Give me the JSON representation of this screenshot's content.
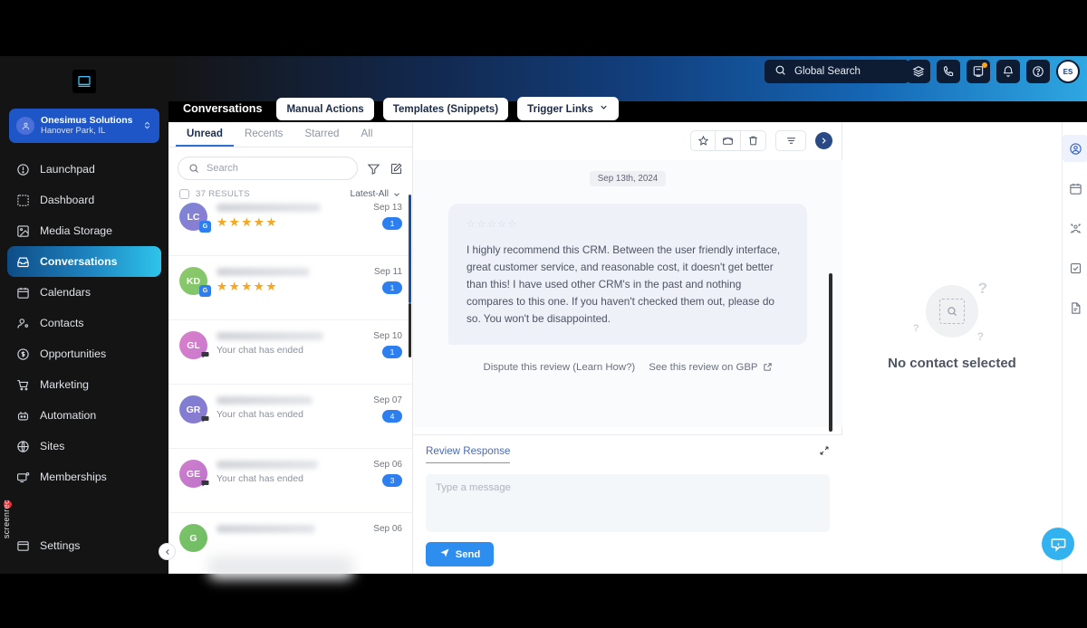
{
  "sidebar": {
    "logo": "app-logo",
    "account": {
      "name": "Onesimus Solutions",
      "location": "Hanover Park, IL"
    },
    "items": [
      {
        "label": "Launchpad",
        "icon": "rocket-icon"
      },
      {
        "label": "Dashboard",
        "icon": "dashboard-icon"
      },
      {
        "label": "Media Storage",
        "icon": "media-icon"
      },
      {
        "label": "Conversations",
        "icon": "inbox-icon"
      },
      {
        "label": "Calendars",
        "icon": "calendar-icon"
      },
      {
        "label": "Contacts",
        "icon": "contacts-icon"
      },
      {
        "label": "Opportunities",
        "icon": "dollar-icon"
      },
      {
        "label": "Marketing",
        "icon": "cart-icon"
      },
      {
        "label": "Automation",
        "icon": "robot-icon"
      },
      {
        "label": "Sites",
        "icon": "globe-icon"
      },
      {
        "label": "Memberships",
        "icon": "monitor-icon"
      }
    ],
    "active": "Conversations",
    "settings": {
      "label": "Settings",
      "icon": "window-icon"
    },
    "recorder": {
      "label": "screenrec"
    }
  },
  "header": {
    "search_placeholder": "Global Search",
    "icons": [
      "layers-icon",
      "phone-icon",
      "note-icon",
      "bell-icon",
      "help-icon"
    ],
    "avatar_initials": "ES"
  },
  "subheader": {
    "title": "Conversations",
    "buttons": [
      {
        "label": "Manual Actions",
        "chevron": false
      },
      {
        "label": "Templates (Snippets)",
        "chevron": false
      },
      {
        "label": "Trigger Links",
        "chevron": true
      }
    ]
  },
  "list": {
    "tabs": [
      {
        "label": "Unread",
        "active": true
      },
      {
        "label": "Recents",
        "active": false
      },
      {
        "label": "Starred",
        "active": false
      },
      {
        "label": "All",
        "active": false
      }
    ],
    "search_placeholder": "Search",
    "results_label": "37 RESULTS",
    "sort_label": "Latest-All",
    "conversations": [
      {
        "initials": "LC",
        "color1": "#7b86d6",
        "color2": "#8f7ad2",
        "type": "review",
        "stars": 5,
        "date": "Sep 13",
        "count": "1",
        "badge": "gbp-icon"
      },
      {
        "initials": "KD",
        "color1": "#8dc96b",
        "color2": "#7ec46a",
        "type": "review",
        "stars": 5,
        "date": "Sep 11",
        "count": "1",
        "badge": "gbp-icon"
      },
      {
        "initials": "GL",
        "color1": "#d97fc9",
        "color2": "#c97ad0",
        "type": "chat",
        "subtitle": "Your chat has ended",
        "date": "Sep 10",
        "count": "1",
        "badge": "chat-icon"
      },
      {
        "initials": "GR",
        "color1": "#7a7fd4",
        "color2": "#8e7ad0",
        "type": "chat",
        "subtitle": "Your chat has ended",
        "date": "Sep 07",
        "count": "4",
        "badge": "chat-icon"
      },
      {
        "initials": "GE",
        "color1": "#cf7ecd",
        "color2": "#bd74cc",
        "type": "chat",
        "subtitle": "Your chat has ended",
        "date": "Sep 06",
        "count": "3",
        "badge": "chat-icon"
      },
      {
        "initials": "G",
        "color1": "#7cc36a",
        "color2": "#6fbd63",
        "type": "chat",
        "subtitle": "",
        "date": "Sep 06",
        "count": "",
        "badge": "chat-icon"
      }
    ]
  },
  "message": {
    "toolbar_icons": [
      "star-icon",
      "mark-unread-icon",
      "delete-icon",
      "filter-icon",
      "expand-panel-icon"
    ],
    "date_chip": "Sep 13th, 2024",
    "review": {
      "stars_shown": 5,
      "body": "I highly recommend this CRM. Between the user friendly interface, great customer service, and reasonable cost, it doesn't get better than this! I have used other CRM's in the past and nothing compares to this one. If you haven't checked them out, please do so. You won't be disappointed."
    },
    "links": [
      {
        "label": "Dispute this review (Learn How?)",
        "external": false
      },
      {
        "label": "See this review on GBP",
        "external": true
      }
    ]
  },
  "reply": {
    "tab_label": "Review Response",
    "expand_icon": "collapse-icon",
    "textarea_placeholder": "Type a message",
    "send_label": "Send",
    "send_icon": "send-icon"
  },
  "contact_panel": {
    "empty_title": "No contact selected",
    "empty_icon": "search-box-icon"
  },
  "rail": {
    "items": [
      {
        "icon": "person-icon",
        "active": true
      },
      {
        "icon": "calendar-icon",
        "active": false
      },
      {
        "icon": "team-icon",
        "active": false
      },
      {
        "icon": "tasks-icon",
        "active": false
      },
      {
        "icon": "document-icon",
        "active": false
      }
    ]
  },
  "floating": {
    "collapse_icon": "chevron-left-icon",
    "chat_widget_icon": "info-chat-icon"
  },
  "colors": {
    "accent_blue": "#2d7ff0",
    "sidebar_bg": "#141414",
    "active_nav_start": "#0e4c86",
    "active_nav_end": "#2ec4ea",
    "star_gold": "#f5a623"
  }
}
